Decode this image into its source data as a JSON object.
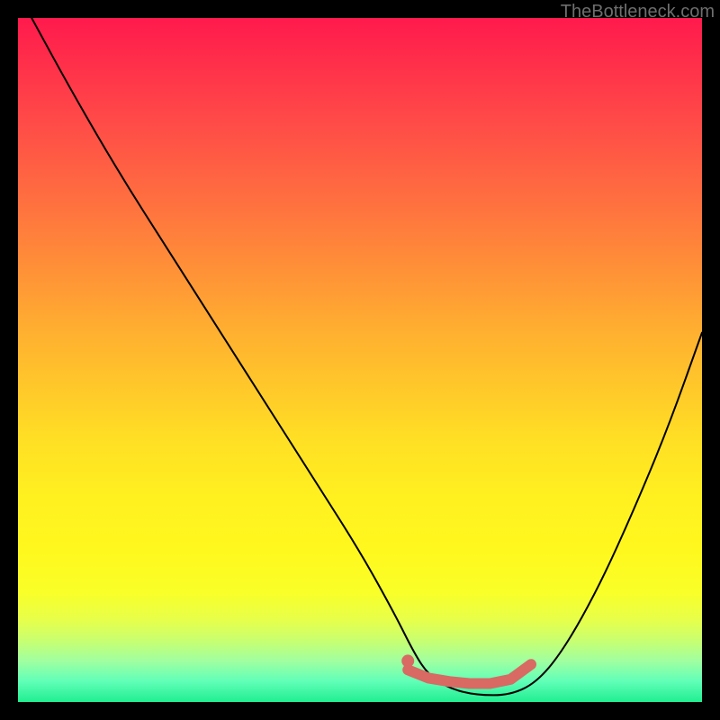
{
  "watermark": "TheBottleneck.com",
  "chart_data": {
    "type": "line",
    "title": "",
    "xlabel": "",
    "ylabel": "",
    "xlim": [
      0,
      100
    ],
    "ylim": [
      0,
      100
    ],
    "series": [
      {
        "name": "curve",
        "x": [
          2,
          8,
          15,
          22,
          29,
          36,
          43,
          50,
          55,
          58,
          60,
          63,
          67,
          72,
          76,
          80,
          85,
          90,
          95,
          100
        ],
        "values": [
          100,
          89,
          77,
          66,
          55,
          44,
          33,
          22,
          13,
          7,
          4,
          2,
          1,
          1,
          3,
          8,
          17,
          28,
          40,
          54
        ]
      }
    ],
    "highlight": {
      "name": "optimal-range",
      "x": [
        57,
        60,
        63,
        66,
        69,
        72,
        75
      ],
      "values": [
        4.7,
        3.5,
        3.0,
        2.7,
        2.7,
        3.3,
        5.5
      ],
      "marker_radius": 5
    },
    "highlight_dot": {
      "x": 57,
      "y": 6.0,
      "radius": 7
    },
    "colors": {
      "curve": "#000000",
      "highlight": "#d86a63"
    }
  }
}
